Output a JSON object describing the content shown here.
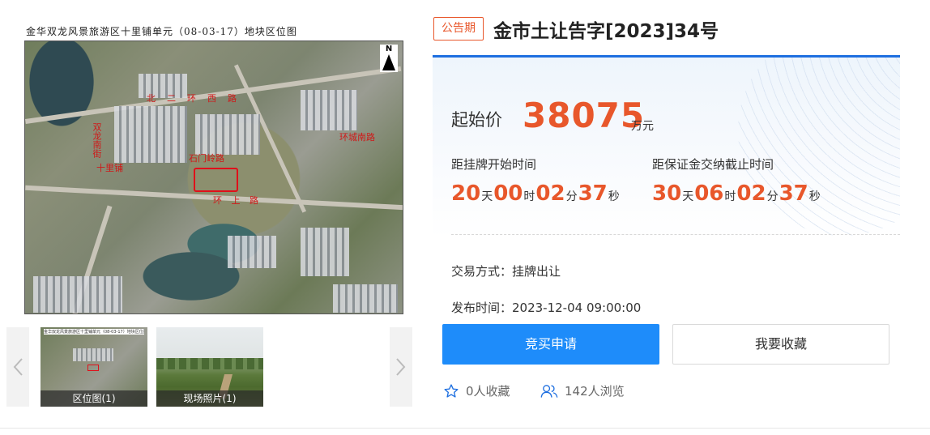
{
  "gallery": {
    "map_title": "金华双龙风景旅游区十里铺单元（08-03-17）地块区位图",
    "map_labels": [
      "北二环西路",
      "双龙南街",
      "十里铺",
      "石门岭路",
      "双龙南街",
      "十里铺村",
      "环城南路",
      "环  上  路"
    ],
    "north_label": "N",
    "thumbnails": [
      {
        "caption": "区位图(1)"
      },
      {
        "caption": "现场照片(1)"
      }
    ],
    "prev_icon": "chevron-left-icon",
    "next_icon": "chevron-right-icon"
  },
  "header": {
    "badge": "公告期",
    "title": "金市土让告字[2023]34号"
  },
  "price": {
    "label": "起始价",
    "value": "38075",
    "unit": "万元"
  },
  "countdowns": [
    {
      "label": "距挂牌开始时间",
      "days": "20",
      "hours": "00",
      "minutes": "02",
      "seconds": "37"
    },
    {
      "label": "距保证金交纳截止时间",
      "days": "30",
      "hours": "06",
      "minutes": "02",
      "seconds": "37"
    }
  ],
  "units": {
    "day": "天",
    "hour": "时",
    "minute": "分",
    "second": "秒"
  },
  "info": {
    "trade_method": "交易方式：挂牌出让",
    "publish_time": "发布时间：2023-12-04 09:00:00"
  },
  "actions": {
    "apply": "竞买申请",
    "favorite": "我要收藏"
  },
  "stats": {
    "favorites": "0人收藏",
    "views": "142人浏览"
  },
  "colors": {
    "accent": "#e8572b",
    "primary": "#1e8cfa",
    "line": "#1e6fe0"
  }
}
